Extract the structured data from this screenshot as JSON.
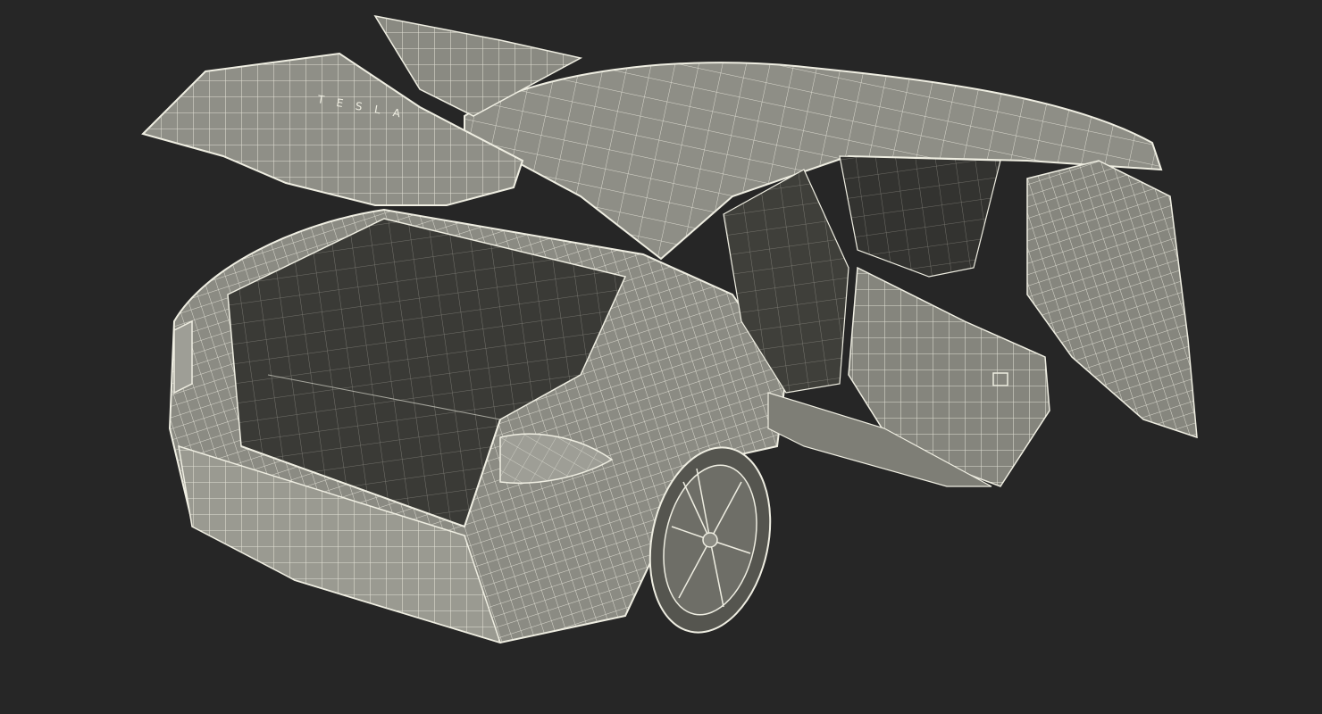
{
  "scene": {
    "subject": "",
    "background_color": "#262626",
    "surface_color": "#8b8b83",
    "surface_dark_color": "#4b4b45",
    "interior_color": "#3a3a36",
    "wire_color": "#efeee2",
    "badge_text": "TESLA"
  }
}
